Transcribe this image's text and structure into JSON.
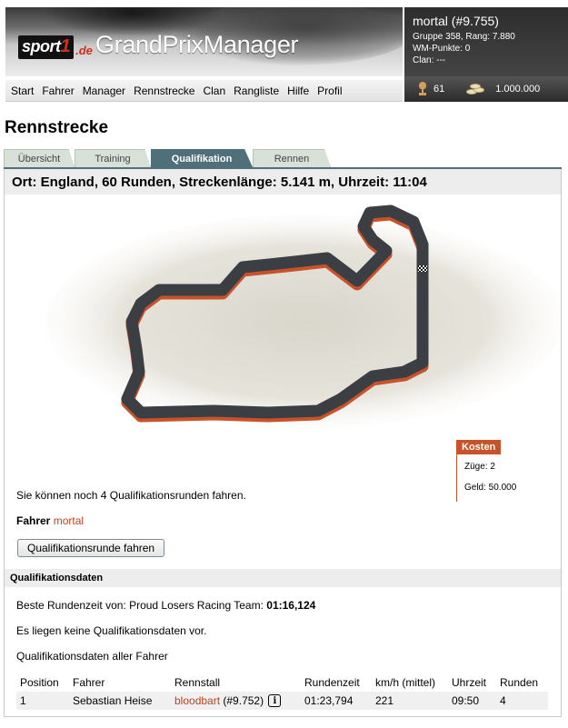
{
  "brand": {
    "sport": "sport",
    "one": "1",
    "domain": ".de",
    "title": "GrandPrixManager"
  },
  "user": {
    "name": "mortal (#9.755)",
    "group": "Gruppe 358, Rang: 7.880",
    "wm_points": "WM-Punkte: 0",
    "clan": "Clan: ---",
    "cups": "61",
    "money": "1.000.000"
  },
  "nav": [
    "Start",
    "Fahrer",
    "Manager",
    "Rennstrecke",
    "Clan",
    "Rangliste",
    "Hilfe",
    "Profil"
  ],
  "page_title": "Rennstrecke",
  "tabs": [
    "Übersicht",
    "Training",
    "Qualifikation",
    "Rennen"
  ],
  "active_tab": "Qualifikation",
  "location": "Ort: England, 60 Runden, Streckenlänge: 5.141 m, Uhrzeit: 11:04",
  "costs": {
    "title": "Kosten",
    "moves": "Züge: 2",
    "money": "Geld: 50.000"
  },
  "quali_remaining": "Sie können noch 4 Qualifikationsrunden fahren.",
  "driver": {
    "label": "Fahrer",
    "name": "mortal"
  },
  "run_button": "Qualifikationsrunde fahren",
  "quali_data": {
    "title": "Qualifikationsdaten",
    "best_lap_prefix": "Beste Rundenzeit von: Proud Losers Racing Team: ",
    "best_lap_time": "01:16,124",
    "no_data": "Es liegen keine Qualifikationsdaten vor.",
    "all_drivers": "Qualifikationsdaten aller Fahrer"
  },
  "table": {
    "headers": [
      "Position",
      "Fahrer",
      "Rennstall",
      "Rundenzeit",
      "km/h (mittel)",
      "Uhrzeit",
      "Runden"
    ],
    "rows": [
      {
        "position": "1",
        "driver": "Sebastian Heise",
        "team": "bloodbart",
        "team_id": "(#9.752)",
        "lap_time": "01:23,794",
        "speed": "221",
        "time": "09:50",
        "laps": "4"
      }
    ]
  },
  "colors": {
    "accent": "#c8522a",
    "tab_active": "#4f6f7a",
    "link": "#b8431f"
  }
}
